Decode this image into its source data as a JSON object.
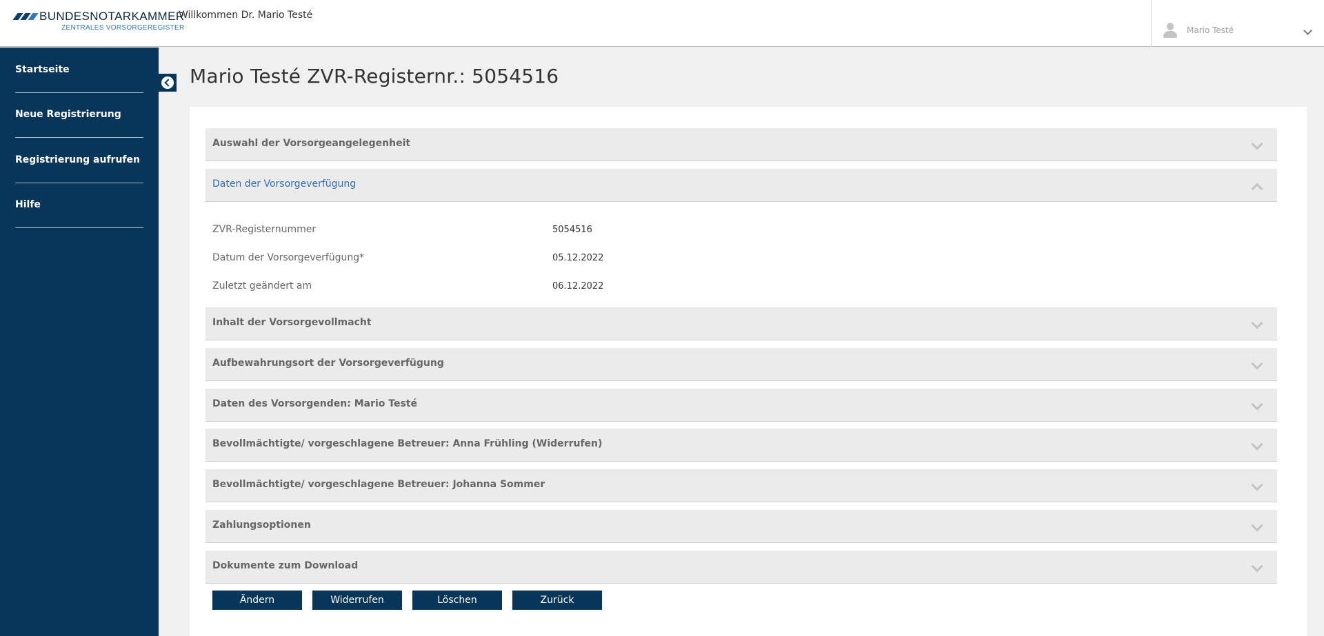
{
  "header": {
    "logo": {
      "name": "BUNDESNOTARKAMMER",
      "subtitle": "ZENTRALES VORSORGEREGISTER"
    },
    "welcome": "Willkommen Dr. Mario Testé",
    "user_menu": {
      "name": "Mario Testé",
      "icon": "user-icon"
    }
  },
  "sidebar": {
    "items": [
      {
        "label": "Startseite"
      },
      {
        "label": "Neue Registrierung"
      },
      {
        "label": "Registrierung aufrufen"
      },
      {
        "label": "Hilfe"
      }
    ],
    "toggle_icon": "chevron-left-circle-icon"
  },
  "main": {
    "title": "Mario Testé ZVR-Registernr.: 5054516",
    "sections": [
      {
        "title": "Auswahl der Vorsorgeangelegenheit",
        "expanded": false
      },
      {
        "title": "Daten der Vorsorgeverfügung",
        "expanded": true
      },
      {
        "title": "Inhalt der Vorsorgevollmacht",
        "expanded": false
      },
      {
        "title": "Aufbewahrungsort der Vorsorgeverfügung",
        "expanded": false
      },
      {
        "title": "Daten des Vorsorgenden: Mario Testé",
        "expanded": false
      },
      {
        "title": "Bevollmächtigte/ vorgeschlagene Betreuer: Anna Frühling (Widerrufen)",
        "expanded": false
      },
      {
        "title": "Bevollmächtigte/ vorgeschlagene Betreuer: Johanna Sommer",
        "expanded": false
      },
      {
        "title": "Zahlungsoptionen",
        "expanded": false
      },
      {
        "title": "Dokumente zum Download",
        "expanded": false
      }
    ],
    "details": [
      {
        "label": "ZVR-Registernummer",
        "value": "5054516"
      },
      {
        "label": "Datum der Vorsorgeverfügung*",
        "value": "05.12.2022"
      },
      {
        "label": "Zuletzt geändert am",
        "value": "06.12.2022"
      }
    ],
    "buttons": [
      {
        "label": "Ändern"
      },
      {
        "label": "Widerrufen"
      },
      {
        "label": "Löschen"
      },
      {
        "label": "Zurück"
      }
    ]
  },
  "colors": {
    "sidebar": "#08365a",
    "accent": "#2e6fb3",
    "button": "#08365a",
    "accordion_bg": "#ebebeb",
    "page_bg": "#f0f0f0"
  }
}
